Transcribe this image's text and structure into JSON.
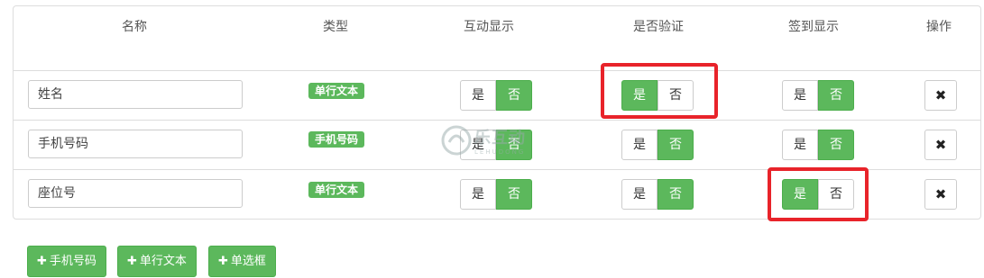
{
  "columns": [
    "名称",
    "类型",
    "互动显示",
    "是否验证",
    "签到显示",
    "操作"
  ],
  "rows": [
    {
      "name": "姓名",
      "type_badge": "单行文本",
      "interactive": {
        "yes": "是",
        "no": "否",
        "selected": "否"
      },
      "verify": {
        "yes": "是",
        "no": "否",
        "selected": "是"
      },
      "signin": {
        "yes": "是",
        "no": "否",
        "selected": "否"
      },
      "delete_icon": "✖"
    },
    {
      "name": "手机号码",
      "type_badge": "手机号码",
      "interactive": {
        "yes": "是",
        "no": "否",
        "selected": "否"
      },
      "verify": {
        "yes": "是",
        "no": "否",
        "selected": "否"
      },
      "signin": {
        "yes": "是",
        "no": "否",
        "selected": "否"
      },
      "delete_icon": "✖"
    },
    {
      "name": "座位号",
      "type_badge": "单行文本",
      "interactive": {
        "yes": "是",
        "no": "否",
        "selected": "否"
      },
      "verify": {
        "yes": "是",
        "no": "否",
        "selected": "否"
      },
      "signin": {
        "yes": "是",
        "no": "否",
        "selected": "是"
      },
      "delete_icon": "✖"
    }
  ],
  "add_buttons": [
    {
      "plus": "✚",
      "label": "手机号码"
    },
    {
      "plus": "✚",
      "label": "单行文本"
    },
    {
      "plus": "✚",
      "label": "单选框"
    }
  ],
  "watermark": {
    "text": "乐互动",
    "sub": "LEHUDONG"
  },
  "colors": {
    "green": "#5cb85c",
    "highlight_red": "#e8232a",
    "border": "#dddddd"
  }
}
